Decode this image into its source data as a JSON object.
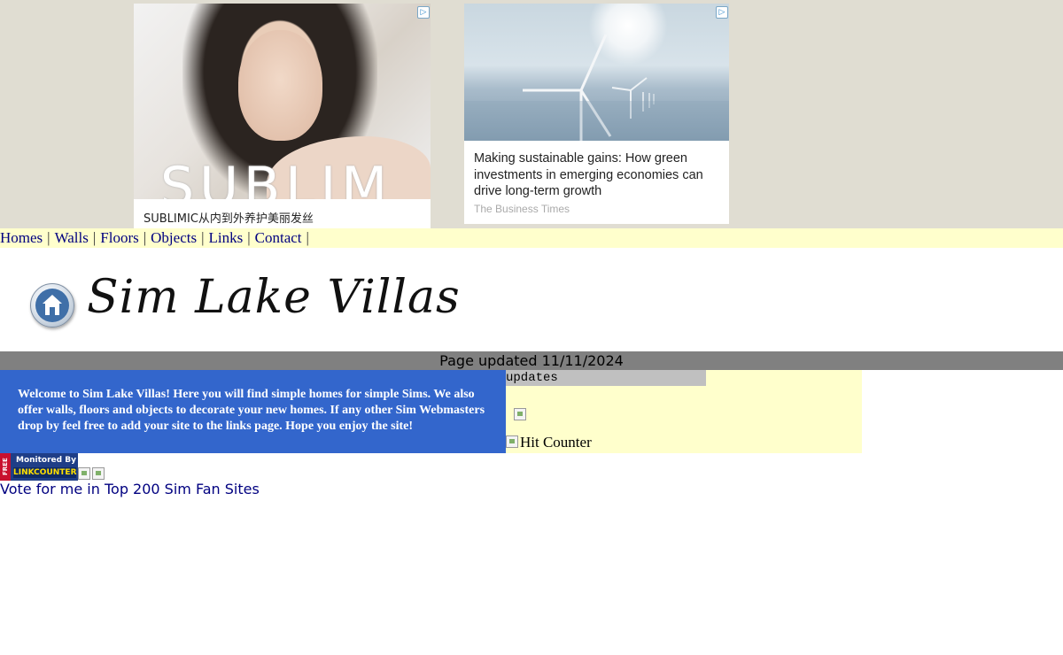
{
  "ads": {
    "ad1": {
      "brand_text": "SUBLIM",
      "caption": "SUBLIMIC从内到外养护美丽发丝",
      "icon": "adchoices-icon"
    },
    "ad2": {
      "title": "Making sustainable gains: How green investments in emerging economies can drive long-term growth",
      "source": "The Business Times",
      "icon": "adchoices-icon"
    }
  },
  "nav": {
    "items": [
      "Homes",
      "Walls",
      "Floors",
      "Objects",
      "Links",
      "Contact"
    ],
    "separator": "|"
  },
  "header": {
    "title": "Sim Lake Villas",
    "logo_icon": "house-globe-icon"
  },
  "updated": {
    "text": "Page updated 11/11/2024"
  },
  "welcome": {
    "text": "Welcome to Sim Lake Villas!  Here you will find simple homes for simple Sims. We also offer walls, floors and objects to decorate your new homes.  If any other Sim Webmasters drop by feel free to add your site to the links page.  Hope you enjoy the site!"
  },
  "updates": {
    "heading": "updates",
    "counter_alt": "Hit Counter"
  },
  "badge": {
    "free": "FREE",
    "line1": "Monitored By",
    "line2": "LINKCOUNTER"
  },
  "vote": {
    "text": "Vote for me in Top 200 Sim Fan Sites"
  },
  "colors": {
    "ad_bg": "#e0ddd2",
    "nav_bg": "#ffffcc",
    "link": "#000080",
    "updated_bar": "#808080",
    "welcome_bg": "#3366cc",
    "updates_head": "#c0c0c0"
  }
}
